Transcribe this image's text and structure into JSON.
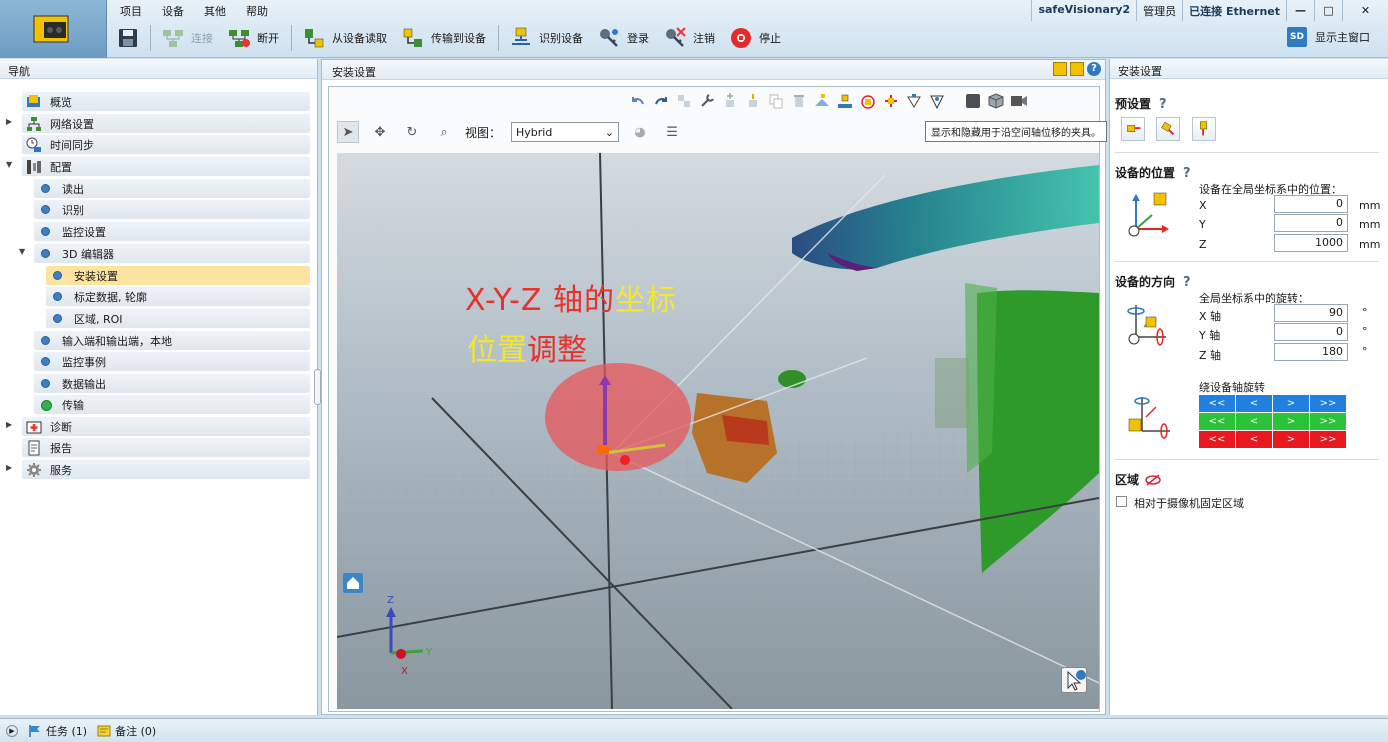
{
  "menu": [
    "项目",
    "设备",
    "其他",
    "帮助"
  ],
  "toolbar": {
    "connect": "连接",
    "disconnect": "断开",
    "read_from_device": "从设备读取",
    "transfer_to_device": "传输到设备",
    "identify_device": "识别设备",
    "login": "登录",
    "logout": "注销",
    "stop": "停止"
  },
  "status_right": {
    "device": "safeVisionary2",
    "user": "管理员",
    "connection": "已连接 Ethernet"
  },
  "show_main_window": "显示主窗口",
  "show_main_icon_text": "SD",
  "nav": {
    "title": "导航",
    "items": [
      {
        "label": "概览"
      },
      {
        "label": "网络设置"
      },
      {
        "label": "时间同步"
      },
      {
        "label": "配置"
      },
      {
        "label": "读出"
      },
      {
        "label": "识别"
      },
      {
        "label": "监控设置"
      },
      {
        "label": "3D 编辑器"
      },
      {
        "label": "安装设置"
      },
      {
        "label": "标定数据, 轮廓"
      },
      {
        "label": "区域, ROI"
      },
      {
        "label": "输入端和输出端，本地"
      },
      {
        "label": "监控事例"
      },
      {
        "label": "数据输出"
      },
      {
        "label": "传输"
      },
      {
        "label": "诊断"
      },
      {
        "label": "报告"
      },
      {
        "label": "服务"
      }
    ]
  },
  "center": {
    "title": "安装设置",
    "tooltip": "显示和隐藏用于沿空间轴位移的夹具。",
    "view_label": "视图：",
    "view_value": "Hybrid",
    "overlay": {
      "line1_part1": "X-Y-Z 轴的",
      "line1_part2": "坐标",
      "line2_part1": "位置",
      "line2_part2": "调整"
    },
    "axes": {
      "z": "Z",
      "y": "Y",
      "x": "X"
    }
  },
  "right": {
    "title": "安装设置",
    "presets_title": "预设置",
    "position_title": "设备的位置",
    "position_desc": "设备在全局坐标系中的位置：",
    "position": [
      {
        "label": "X",
        "value": "0",
        "unit": "mm"
      },
      {
        "label": "Y",
        "value": "0",
        "unit": "mm"
      },
      {
        "label": "Z",
        "value": "1000",
        "unit": "mm"
      }
    ],
    "orientation_title": "设备的方向",
    "orientation_desc": "全局坐标系中的旋转：",
    "rotation": [
      {
        "label": "X 轴",
        "value": "90",
        "unit": "°"
      },
      {
        "label": "Y 轴",
        "value": "0",
        "unit": "°"
      },
      {
        "label": "Z 轴",
        "value": "180",
        "unit": "°"
      }
    ],
    "axis_rotate_label": "绕设备轴旋转",
    "rot_buttons": [
      "<<",
      "<",
      ">",
      ">>"
    ],
    "zone_title": "区域",
    "fixed_zone_label": "相对于摄像机固定区域"
  },
  "bottom": {
    "tasks": "任务 (1)",
    "notes": "备注 (0)"
  },
  "colors": {
    "accent_blue": "#1f80e0",
    "accent_green": "#2bc33a",
    "accent_red": "#e8181f",
    "selected_row": "#fde3a0"
  }
}
